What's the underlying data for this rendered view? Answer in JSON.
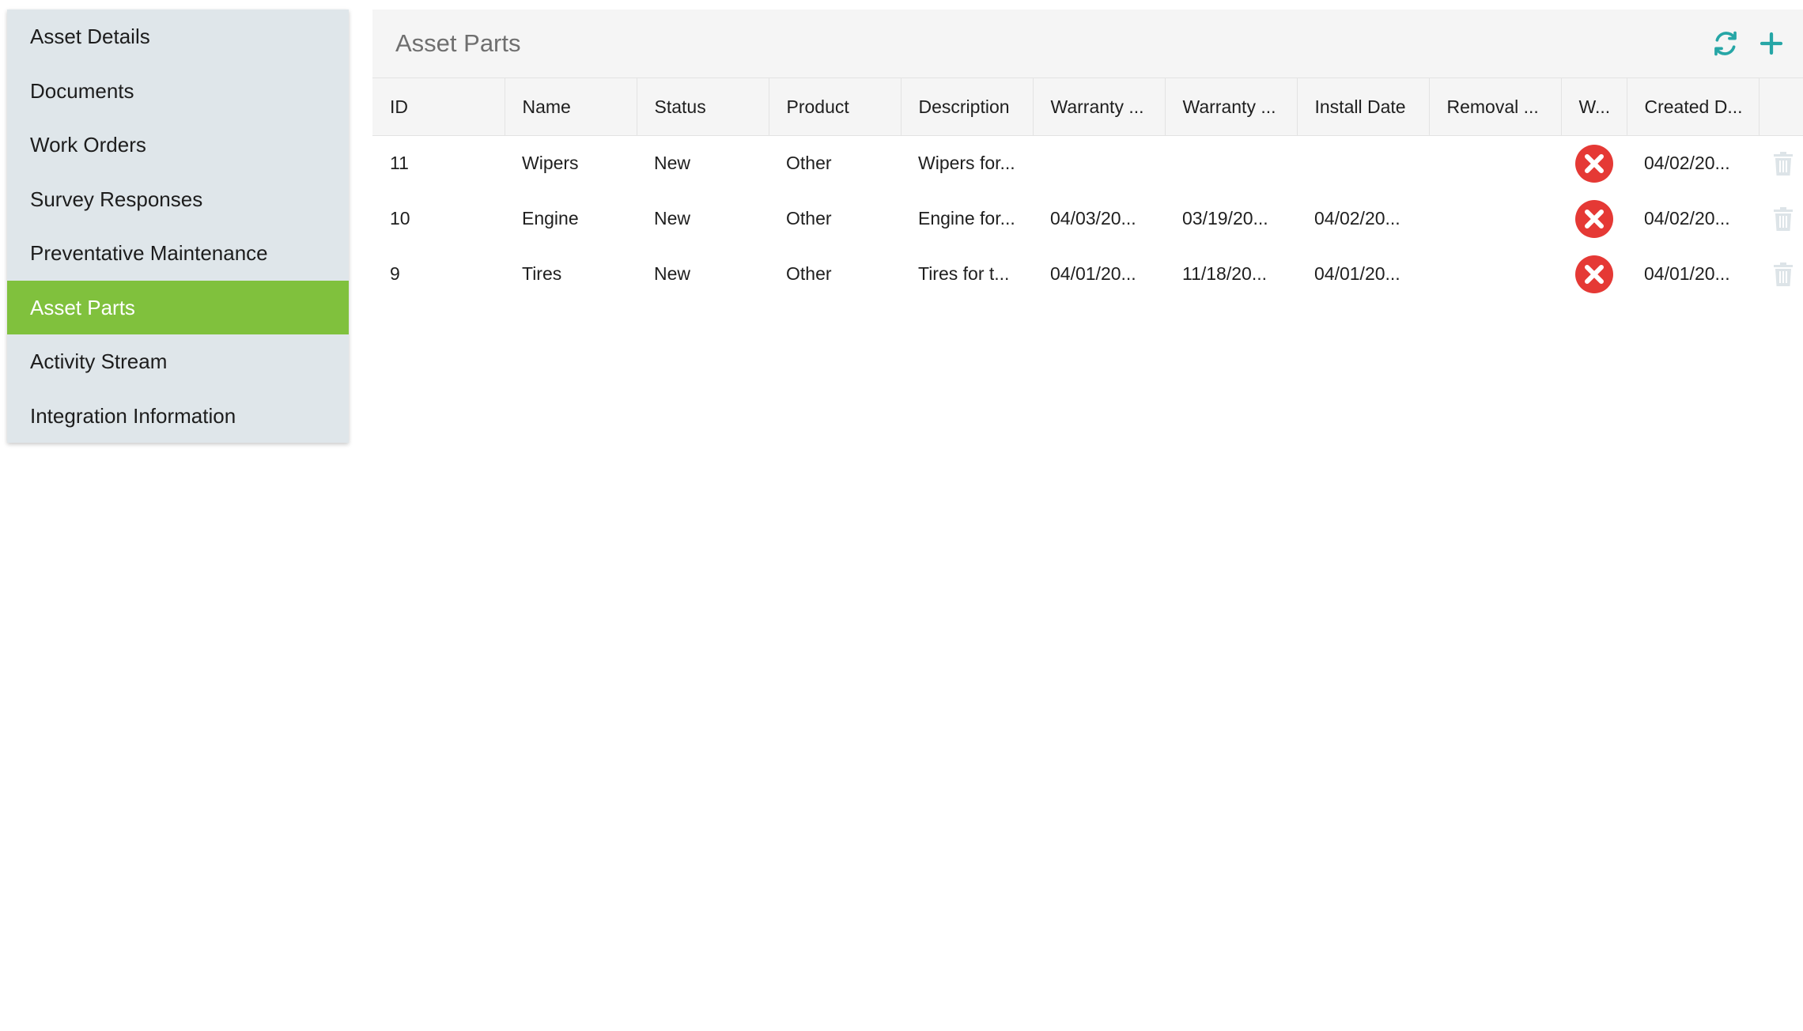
{
  "sidebar": {
    "items": [
      {
        "label": "Asset Details"
      },
      {
        "label": "Documents"
      },
      {
        "label": "Work Orders"
      },
      {
        "label": "Survey Responses"
      },
      {
        "label": "Preventative Maintenance"
      },
      {
        "label": "Asset Parts",
        "active": true
      },
      {
        "label": "Activity Stream"
      },
      {
        "label": "Integration Information"
      }
    ]
  },
  "panel": {
    "title": "Asset Parts",
    "icons": {
      "refresh": "refresh-icon",
      "add": "plus-icon"
    }
  },
  "table": {
    "columns": [
      "ID",
      "Name",
      "Status",
      "Product",
      "Description",
      "Warranty ...",
      "Warranty ...",
      "Install Date",
      "Removal ...",
      "W...",
      "Created D...",
      ""
    ],
    "rows": [
      {
        "id": "11",
        "name": "Wipers",
        "status": "New",
        "product": "Other",
        "description": "Wipers for...",
        "warranty_start": "",
        "warranty_end": "",
        "install_date": "",
        "removal": "",
        "w_icon": "x-circle-icon",
        "created": "04/02/20..."
      },
      {
        "id": "10",
        "name": "Engine",
        "status": "New",
        "product": "Other",
        "description": "Engine for...",
        "warranty_start": "04/03/20...",
        "warranty_end": "03/19/20...",
        "install_date": "04/02/20...",
        "removal": "",
        "w_icon": "x-circle-icon",
        "created": "04/02/20..."
      },
      {
        "id": "9",
        "name": "Tires",
        "status": "New",
        "product": "Other",
        "description": "Tires for t...",
        "warranty_start": "04/01/20...",
        "warranty_end": "11/18/20...",
        "install_date": "04/01/20...",
        "removal": "",
        "w_icon": "x-circle-icon",
        "created": "04/01/20..."
      }
    ]
  },
  "colors": {
    "accent": "#80c13d",
    "teal": "#26a6a6",
    "danger": "#e53935",
    "sidebar_bg": "#dfe6ea"
  }
}
